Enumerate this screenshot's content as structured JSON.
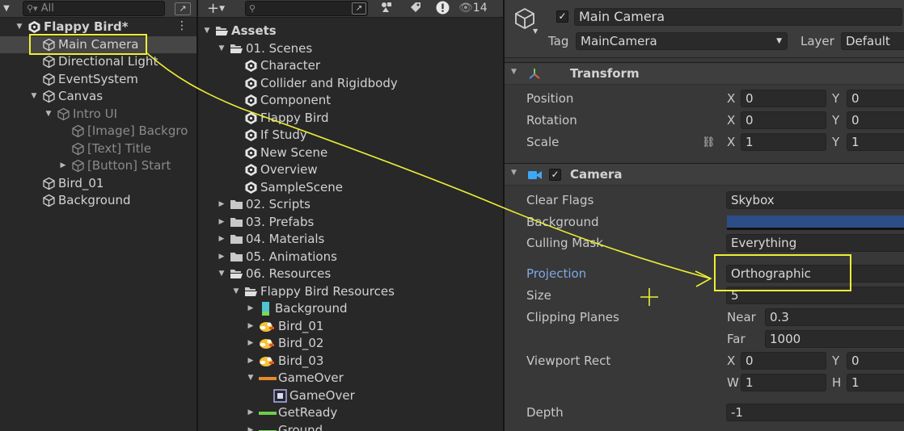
{
  "hierarchy": {
    "search_placeholder": "All",
    "items": [
      {
        "label": "Flappy Bird*",
        "bold": true,
        "depth": 0,
        "arrow": "down",
        "icon": "unity-scene",
        "dim": false
      },
      {
        "label": "Main Camera",
        "depth": 1,
        "arrow": "",
        "icon": "gameobject",
        "dim": false,
        "selected": true
      },
      {
        "label": "Directional Light",
        "depth": 1,
        "arrow": "",
        "icon": "gameobject",
        "dim": false
      },
      {
        "label": "EventSystem",
        "depth": 1,
        "arrow": "",
        "icon": "gameobject",
        "dim": false
      },
      {
        "label": "Canvas",
        "depth": 1,
        "arrow": "down",
        "icon": "gameobject",
        "dim": false
      },
      {
        "label": "Intro UI",
        "depth": 2,
        "arrow": "down",
        "icon": "gameobject",
        "dim": true
      },
      {
        "label": "[Image] Backgro",
        "depth": 3,
        "arrow": "",
        "icon": "gameobject",
        "dim": true
      },
      {
        "label": "[Text] Title",
        "depth": 3,
        "arrow": "",
        "icon": "gameobject",
        "dim": true
      },
      {
        "label": "[Button] Start",
        "depth": 3,
        "arrow": "right",
        "icon": "gameobject",
        "dim": true
      },
      {
        "label": "Bird_01",
        "depth": 1,
        "arrow": "",
        "icon": "gameobject",
        "dim": false
      },
      {
        "label": "Background",
        "depth": 1,
        "arrow": "",
        "icon": "gameobject",
        "dim": false
      }
    ]
  },
  "project": {
    "add_label": "+",
    "hidden_count": "14",
    "items": [
      {
        "label": "Assets",
        "bold": true,
        "depth": 0,
        "arrow": "down",
        "icon": "folder-open"
      },
      {
        "label": "01. Scenes",
        "depth": 1,
        "arrow": "down",
        "icon": "folder-open"
      },
      {
        "label": "Character",
        "depth": 2,
        "arrow": "",
        "icon": "unity-scene"
      },
      {
        "label": "Collider and Rigidbody",
        "depth": 2,
        "arrow": "",
        "icon": "unity-scene"
      },
      {
        "label": "Component",
        "depth": 2,
        "arrow": "",
        "icon": "unity-scene"
      },
      {
        "label": "Flappy Bird",
        "depth": 2,
        "arrow": "",
        "icon": "unity-scene"
      },
      {
        "label": "If Study",
        "depth": 2,
        "arrow": "",
        "icon": "unity-scene"
      },
      {
        "label": "New Scene",
        "depth": 2,
        "arrow": "",
        "icon": "unity-scene"
      },
      {
        "label": "Overview",
        "depth": 2,
        "arrow": "",
        "icon": "unity-scene"
      },
      {
        "label": "SampleScene",
        "depth": 2,
        "arrow": "",
        "icon": "unity-scene"
      },
      {
        "label": "02. Scripts",
        "depth": 1,
        "arrow": "right",
        "icon": "folder"
      },
      {
        "label": "03. Prefabs",
        "depth": 1,
        "arrow": "right",
        "icon": "folder"
      },
      {
        "label": "04. Materials",
        "depth": 1,
        "arrow": "right",
        "icon": "folder"
      },
      {
        "label": "05. Animations",
        "depth": 1,
        "arrow": "right",
        "icon": "folder"
      },
      {
        "label": "06. Resources",
        "depth": 1,
        "arrow": "down",
        "icon": "folder-open"
      },
      {
        "label": "Flappy Bird Resources",
        "depth": 2,
        "arrow": "down",
        "icon": "folder-open"
      },
      {
        "label": "Background",
        "depth": 3,
        "arrow": "right",
        "icon": "sprite-background"
      },
      {
        "label": "Bird_01",
        "depth": 3,
        "arrow": "right",
        "icon": "sprite-bird"
      },
      {
        "label": "Bird_02",
        "depth": 3,
        "arrow": "right",
        "icon": "sprite-bird"
      },
      {
        "label": "Bird_03",
        "depth": 3,
        "arrow": "right",
        "icon": "sprite-bird"
      },
      {
        "label": "GameOver",
        "depth": 3,
        "arrow": "down",
        "icon": "sprite-gameover"
      },
      {
        "label": "GameOver",
        "depth": 4,
        "arrow": "",
        "icon": "sprite-frame"
      },
      {
        "label": "GetReady",
        "depth": 3,
        "arrow": "right",
        "icon": "sprite-getready"
      },
      {
        "label": "Ground",
        "depth": 3,
        "arrow": "right",
        "icon": "sprite-ground"
      }
    ]
  },
  "inspector": {
    "object_name": "Main Camera",
    "tag_label": "Tag",
    "tag_value": "MainCamera",
    "layer_label": "Layer",
    "layer_value": "Default",
    "transform": {
      "title": "Transform",
      "position_label": "Position",
      "rotation_label": "Rotation",
      "scale_label": "Scale",
      "x_label": "X",
      "y_label": "Y",
      "position": {
        "x": "0",
        "y": "0"
      },
      "rotation": {
        "x": "0",
        "y": "0"
      },
      "scale": {
        "x": "1",
        "y": "1"
      }
    },
    "camera": {
      "title": "Camera",
      "clear_flags_label": "Clear Flags",
      "clear_flags_value": "Skybox",
      "background_label": "Background",
      "background_color": "#2d4d86",
      "culling_mask_label": "Culling Mask",
      "culling_mask_value": "Everything",
      "projection_label": "Projection",
      "projection_value": "Orthographic",
      "size_label": "Size",
      "size_value": "5",
      "clipping_label": "Clipping Planes",
      "near_label": "Near",
      "near_value": "0.3",
      "far_label": "Far",
      "far_value": "1000",
      "viewport_label": "Viewport Rect",
      "x_label": "X",
      "y_label": "Y",
      "w_label": "W",
      "h_label": "H",
      "viewport": {
        "x": "0",
        "y": "0",
        "w": "1",
        "h": "1"
      },
      "depth_label": "Depth",
      "depth_value": "-1"
    }
  },
  "colors": {
    "highlight": "#ecef34",
    "projection_label": "#7fa8e6"
  }
}
